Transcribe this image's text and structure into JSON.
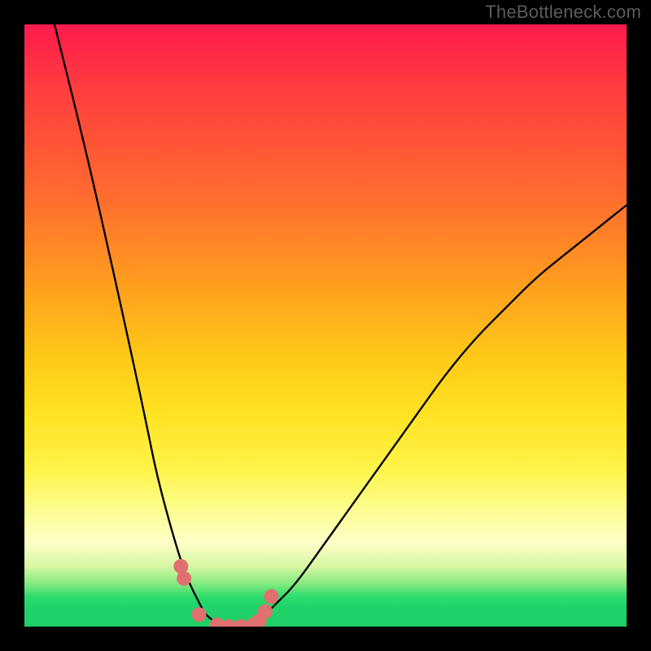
{
  "attribution": "TheBottleneck.com",
  "colors": {
    "frame": "#000000",
    "curve": "#000000",
    "markers": "#e07070",
    "gradient_top": "#ff1a4d",
    "gradient_mid": "#ffe324",
    "gradient_bottom": "#1fcf66"
  },
  "chart_data": {
    "type": "line",
    "title": "",
    "xlabel": "",
    "ylabel": "",
    "xlim": [
      0,
      100
    ],
    "ylim": [
      0,
      100
    ],
    "note": "V-shaped bottleneck curve plotted over a vertical spectrum gradient. The vertical axis represents bottleneck percentage (red = high near 100, green band = ~0–5). The curve reaches its minimum around x≈32–38 where it touches the green band, indicating the balanced configuration. Values are estimated from pixel positions.",
    "series": [
      {
        "name": "bottleneck-curve",
        "x": [
          5,
          10,
          15,
          20,
          22,
          25,
          27,
          29,
          30,
          32,
          34,
          36,
          38,
          40,
          42,
          45,
          50,
          55,
          60,
          65,
          70,
          75,
          80,
          85,
          90,
          95,
          100
        ],
        "y": [
          100,
          80,
          58,
          35,
          25,
          14,
          8,
          4,
          2,
          0.5,
          0,
          0,
          0.5,
          2,
          4,
          7,
          14,
          21,
          28,
          35,
          42,
          48,
          53,
          58,
          62,
          66,
          70
        ]
      }
    ],
    "markers": {
      "name": "highlighted-points",
      "note": "Salmon pink dotted markers clustered at the trough of the curve.",
      "x": [
        26,
        26.5,
        29,
        32,
        34,
        36,
        38,
        39,
        40,
        41
      ],
      "y": [
        10,
        8,
        2,
        0.3,
        0,
        0,
        0.3,
        1,
        2.5,
        5
      ]
    }
  }
}
